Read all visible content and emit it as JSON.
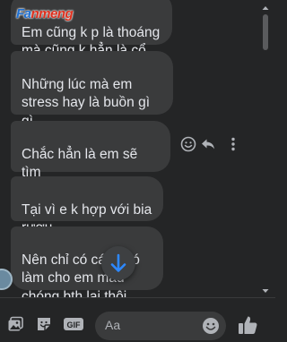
{
  "chat": {
    "messages": [
      {
        "text": "Em cũng k p là thoáng\nmà cũng k hẳn là cổ hủ"
      },
      {
        "text": "Những lúc mà em\nstress hay là buồn gì gì\nđó"
      },
      {
        "text": "Chắc hẳn là em sẽ tìm\nbạn tình"
      },
      {
        "text": "Tại vì e k hợp với bia\nrượu"
      },
      {
        "text": "Nên chỉ có cách đó\nlàm cho em mau\nchóng bth lại thôi"
      }
    ],
    "bubble_color": "#3a3b3c",
    "text_color": "#e4e6eb",
    "watermark": {
      "part1": "Fa",
      "part2": "nmeng"
    }
  },
  "actions": {
    "react_icon": "smiley-icon",
    "reply_icon": "reply-icon",
    "more_icon": "more-vertical-icon"
  },
  "scroll_button": {
    "icon": "arrow-down-icon",
    "color": "#2d88ff"
  },
  "composer": {
    "placeholder": "Aa",
    "icons": [
      "image-icon",
      "sticker-icon",
      "gif-icon",
      "emoji-icon",
      "thumbs-up-icon"
    ],
    "gif_label": "GIF",
    "accent": "#2d88ff"
  }
}
